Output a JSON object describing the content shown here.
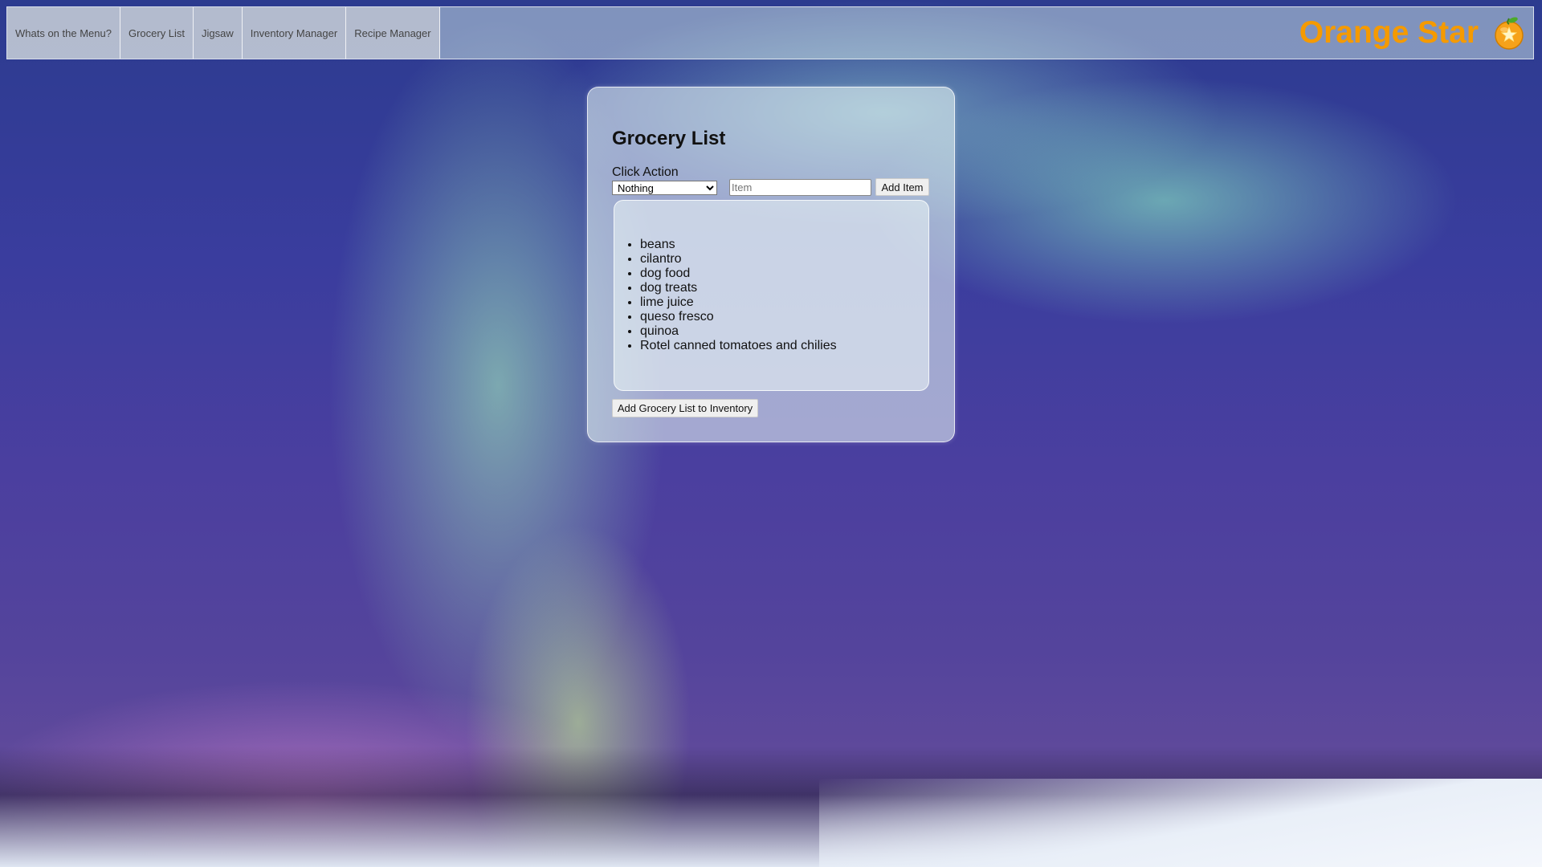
{
  "nav": {
    "items": [
      {
        "label": "Whats on the Menu?"
      },
      {
        "label": "Grocery List"
      },
      {
        "label": "Jigsaw"
      },
      {
        "label": "Inventory Manager"
      },
      {
        "label": "Recipe Manager"
      }
    ]
  },
  "brand": {
    "name": "Orange Star",
    "logo_icon": "orange-star-logo-icon",
    "color": "#f59a00"
  },
  "panel": {
    "title": "Grocery List",
    "click_action_label": "Click Action",
    "click_action_selected": "Nothing",
    "item_placeholder": "Item",
    "item_value": "",
    "add_item_label": "Add Item",
    "items": [
      "beans",
      "cilantro",
      "dog food",
      "dog treats",
      "lime juice",
      "queso fresco",
      "quinoa",
      "Rotel canned tomatoes and chilies"
    ],
    "add_to_inventory_label": "Add Grocery List to Inventory"
  }
}
